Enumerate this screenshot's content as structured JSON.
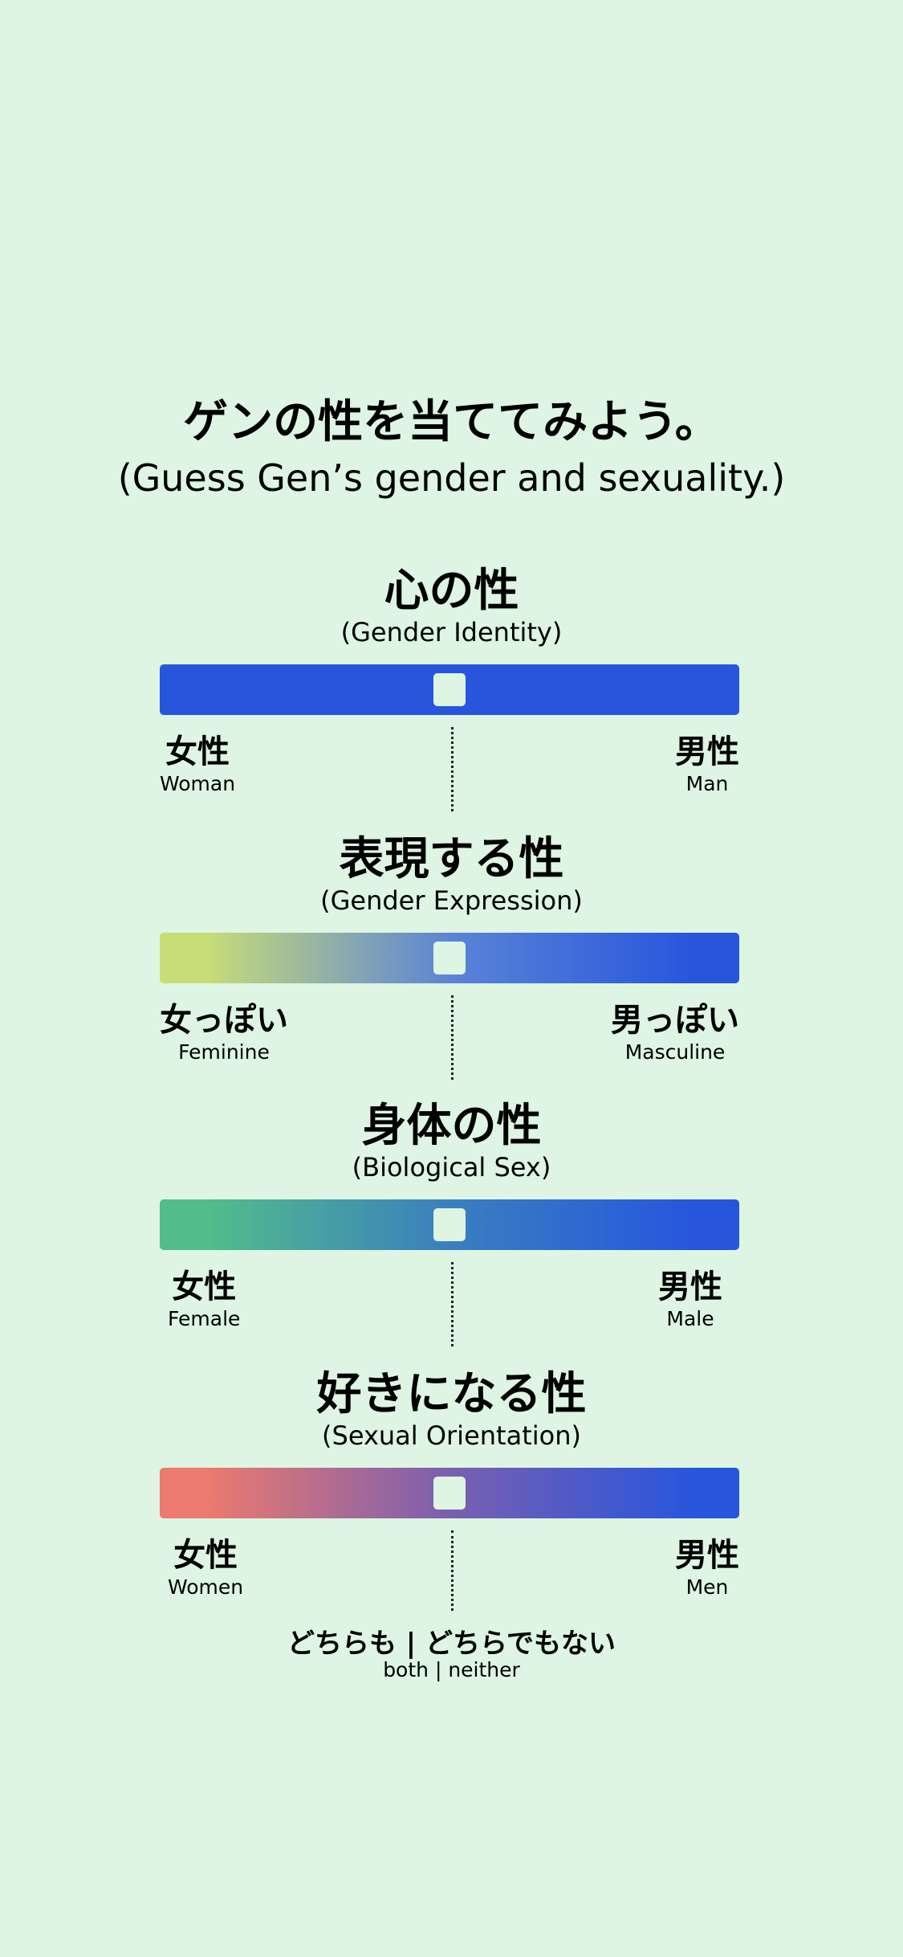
{
  "title": "ゲンの性を当ててみよう。",
  "subtitle": "(Guess Gen’s gender and sexuality.)",
  "colors": {
    "background": "#ddf5e2",
    "blue": "#2756dd"
  },
  "sections": [
    {
      "heading": "心の性",
      "sub": "(Gender Identity)",
      "left_jp": "女性",
      "left_en": "Woman",
      "right_jp": "男性",
      "right_en": "Man",
      "slider_value": 0.5,
      "gradient": [
        "#2756dd",
        "#2756dd"
      ]
    },
    {
      "heading": "表現する性",
      "sub": "(Gender Expression)",
      "left_jp": "女っぽい",
      "left_en": "Feminine",
      "right_jp": "男っぽい",
      "right_en": "Masculine",
      "slider_value": 0.5,
      "gradient": [
        "#c8dc78",
        "#5b84d6",
        "#2756dd"
      ]
    },
    {
      "heading": "身体の性",
      "sub": "(Biological Sex)",
      "left_jp": "女性",
      "left_en": "Female",
      "right_jp": "男性",
      "right_en": "Male",
      "slider_value": 0.5,
      "gradient": [
        "#52bd8a",
        "#3a7fbf",
        "#2756dd"
      ]
    },
    {
      "heading": "好きになる性",
      "sub": "(Sexual Orientation)",
      "left_jp": "女性",
      "left_en": "Women",
      "right_jp": "男性",
      "right_en": "Men",
      "slider_value": 0.5,
      "gradient": [
        "#ec7a6e",
        "#7a5fb0",
        "#2756dd"
      ]
    }
  ],
  "footer": {
    "jp": "どちらも | どちらでもない",
    "en": "both | neither"
  }
}
